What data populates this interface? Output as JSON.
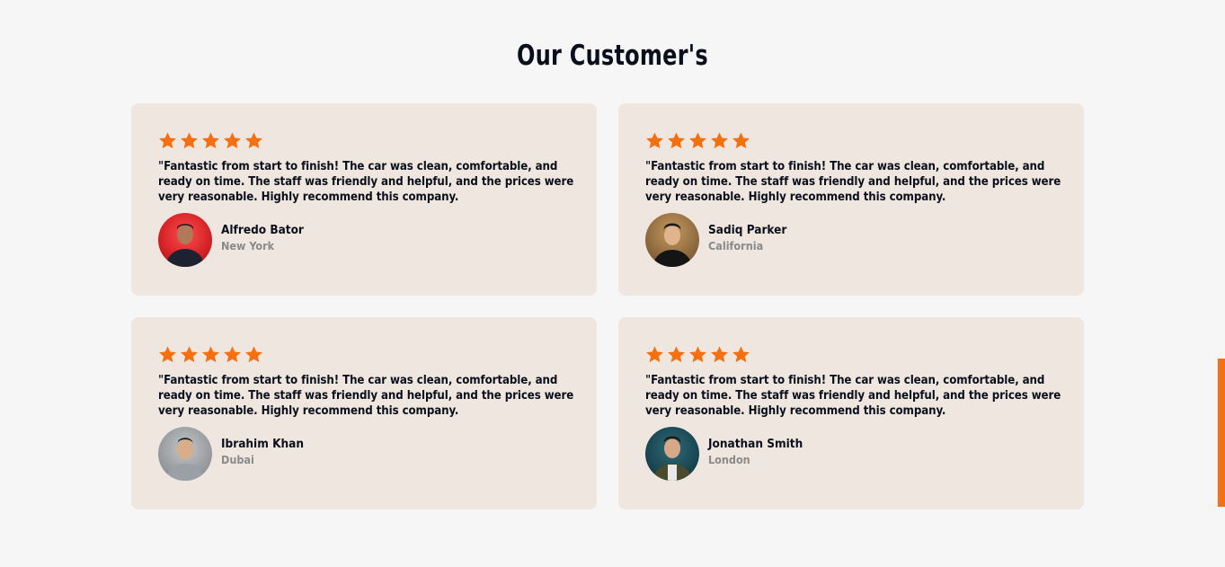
{
  "section": {
    "title": "Our Customer's"
  },
  "colors": {
    "accent": "#f76f0f",
    "card_bg": "#efe7df",
    "page_bg": "#f6f6f6",
    "text": "#0b0f1c",
    "muted": "#8a8a8a"
  },
  "testimonials": [
    {
      "rating": 5,
      "quote": "\"Fantastic from start to finish! The car was clean, comfortable, and ready on time. The staff was friendly and helpful, and the prices were very reasonable. Highly recommend this company.",
      "name": "Alfredo Bator",
      "location": "New York"
    },
    {
      "rating": 5,
      "quote": "\"Fantastic from start to finish! The car was clean, comfortable, and ready on time. The staff was friendly and helpful, and the prices were very reasonable. Highly recommend this company.",
      "name": "Sadiq Parker",
      "location": "California"
    },
    {
      "rating": 5,
      "quote": "\"Fantastic from start to finish! The car was clean, comfortable, and ready on time. The staff was friendly and helpful, and the prices were very reasonable. Highly recommend this company.",
      "name": "Ibrahim Khan",
      "location": "Dubai"
    },
    {
      "rating": 5,
      "quote": "\"Fantastic from start to finish! The car was clean, comfortable, and ready on time. The staff was friendly and helpful, and the prices were very reasonable. Highly recommend this company.",
      "name": "Jonathan Smith",
      "location": "London"
    }
  ]
}
